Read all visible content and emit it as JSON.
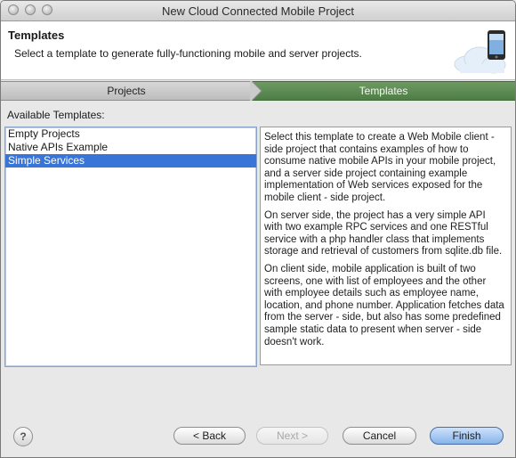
{
  "window": {
    "title": "New Cloud Connected Mobile Project"
  },
  "header": {
    "title": "Templates",
    "description": "Select a template to generate fully-functioning mobile and server projects."
  },
  "steps": [
    {
      "label": "Projects",
      "active": false
    },
    {
      "label": "Templates",
      "active": true
    }
  ],
  "available_label": "Available Templates:",
  "templates": [
    {
      "label": "Empty Projects",
      "selected": false
    },
    {
      "label": "Native APIs Example",
      "selected": false
    },
    {
      "label": "Simple Services",
      "selected": true
    }
  ],
  "description": {
    "p1": "Select this template to create a Web Mobile client - side project that contains examples of how to consume native mobile APIs in your mobile project, and a server side project containing example implementation of Web services exposed for the mobile client - side project.",
    "p2": "On server side, the project has a very simple API with two example RPC services and one RESTful service with a php handler class that implements storage and retrieval of customers from sqlite.db file.",
    "p3": "On client side, mobile application is built of two screens, one with list of employees and the other with employee details such as employee name, location, and phone number. Application fetches data from the server - side, but also has some predefined sample static data to present when server - side doesn't work."
  },
  "footer": {
    "help_glyph": "?",
    "back_label": "< Back",
    "next_label": "Next >",
    "cancel_label": "Cancel",
    "finish_label": "Finish"
  },
  "colors": {
    "active_step": "#5b8a52",
    "selection": "#3875d7",
    "default_button": "#86b3ea"
  },
  "icons": {
    "header_art": "mobile-cloud-icon",
    "help": "help-icon"
  }
}
